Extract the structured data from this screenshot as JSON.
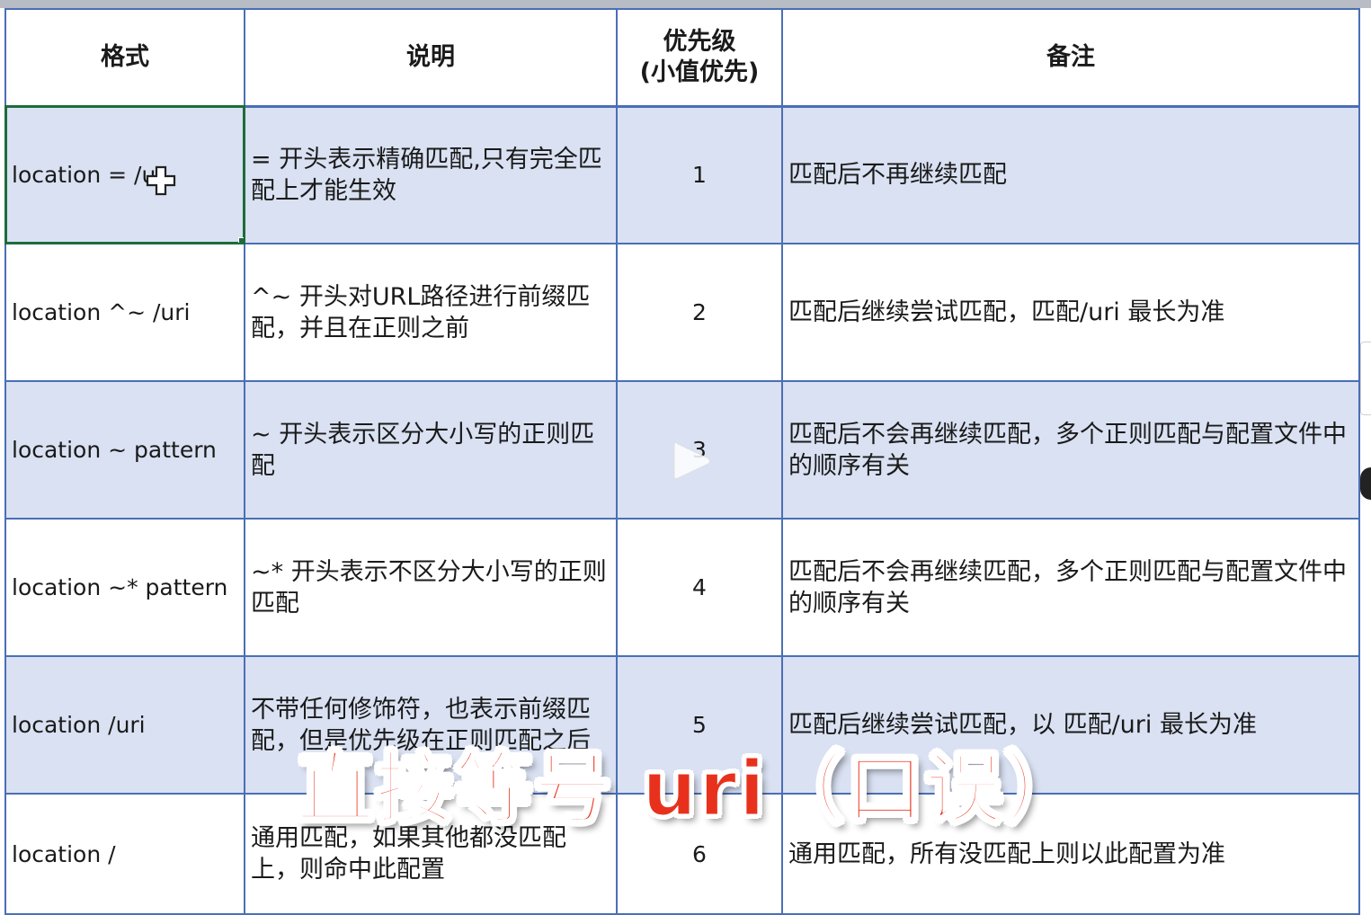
{
  "table": {
    "headers": {
      "format": "格式",
      "description": "说明",
      "priority_line1": "优先级",
      "priority_line2": "(小值优先)",
      "note": "备注"
    },
    "rows": [
      {
        "format": "location = /u",
        "description": "= 开头表示精确匹配,只有完全匹配上才能生效",
        "priority": "1",
        "note": "匹配后不再继续匹配"
      },
      {
        "format": "location ^~ /uri",
        "description": "^~ 开头对URL路径进行前缀匹配，并且在正则之前",
        "priority": "2",
        "note": "匹配后继续尝试匹配，匹配/uri 最长为准"
      },
      {
        "format": "location ~ pattern",
        "description": "~ 开头表示区分大小写的正则匹配",
        "priority": "3",
        "note": "匹配后不会再继续匹配，多个正则匹配与配置文件中的顺序有关"
      },
      {
        "format": "location ~* pattern",
        "description": "~* 开头表示不区分大小写的正则匹配",
        "priority": "4",
        "note": "匹配后不会再继续匹配，多个正则匹配与配置文件中的顺序有关"
      },
      {
        "format": "location /uri",
        "description": "不带任何修饰符，也表示前缀匹配，但是优先级在正则匹配之后",
        "priority": "5",
        "note": "匹配后继续尝试匹配，以 匹配/uri 最长为准"
      },
      {
        "format": "location /",
        "description": "通用匹配，如果其他都没匹配上，则命中此配置",
        "priority": "6",
        "note": "通用匹配，所有没匹配上则以此配置为准"
      }
    ]
  },
  "overlay": {
    "caption": "直接等号 uri（口误）",
    "play_icon": "play-icon",
    "cursor_icon": "cell-select-cursor-icon"
  },
  "colors": {
    "grid_border": "#4a6fb5",
    "row_shade": "#d9e1f2",
    "selection": "#1e6b3a",
    "caption_red": "#e8311c"
  }
}
